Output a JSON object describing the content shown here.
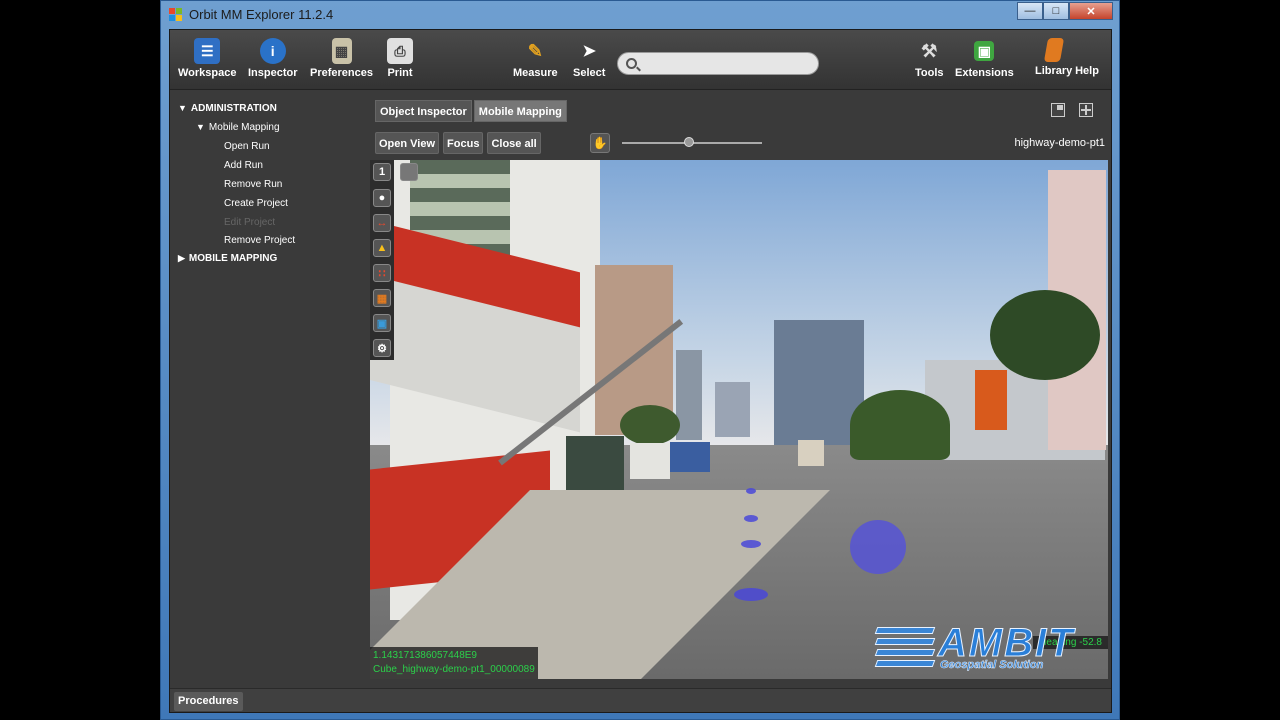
{
  "window": {
    "title": "Orbit MM Explorer 11.2.4"
  },
  "toolbar": {
    "left": [
      {
        "label": "Workspace",
        "icon": "workspace-icon",
        "color": "#2f6fc4"
      },
      {
        "label": "Inspector",
        "icon": "info-icon",
        "color": "#2a72c8"
      },
      {
        "label": "Preferences",
        "icon": "preferences-icon",
        "color": "#c9c2a8"
      },
      {
        "label": "Print",
        "icon": "printer-icon",
        "color": "#e0e0e0"
      }
    ],
    "center": [
      {
        "label": "Measure",
        "icon": "ruler-icon",
        "color": "#e0a020"
      },
      {
        "label": "Select",
        "icon": "cursor-icon",
        "color": "#ffffff"
      }
    ],
    "right": [
      {
        "label": "Tools",
        "icon": "tools-icon",
        "color": "#dddddd"
      },
      {
        "label": "Extensions",
        "icon": "extensions-icon",
        "color": "#3fa640"
      },
      {
        "label": "Library",
        "icon": "library-icon",
        "color": "#e07a20"
      },
      {
        "label": "Help",
        "icon": "help-icon",
        "color": "#4a90d9"
      }
    ],
    "search_placeholder": ""
  },
  "sidebar": {
    "administration": "ADMINISTRATION",
    "mobile_mapping_sub": "Mobile Mapping",
    "items": [
      "Open Run",
      "Add Run",
      "Remove Run",
      "Create Project",
      "Edit Project",
      "Remove Project"
    ],
    "mobile_mapping": "MOBILE MAPPING"
  },
  "tabs": [
    "Object Inspector",
    "Mobile Mapping"
  ],
  "view_buttons": [
    "Open View",
    "Focus",
    "Close all"
  ],
  "slider": {
    "value": 0.48
  },
  "view_name": "highway-demo-pt1",
  "viewport": {
    "readout_line1": "1.143171386057448E9",
    "readout_line2": "Cube_highway-demo-pt1_00000089",
    "heading": "Heading -52.8"
  },
  "view_tools": [
    "1",
    "",
    "",
    "",
    "",
    "",
    "",
    ""
  ],
  "logo": {
    "name": "AMBIT",
    "tagline": "Geospatial Solution"
  },
  "bottom": {
    "procedures": "Procedures"
  }
}
